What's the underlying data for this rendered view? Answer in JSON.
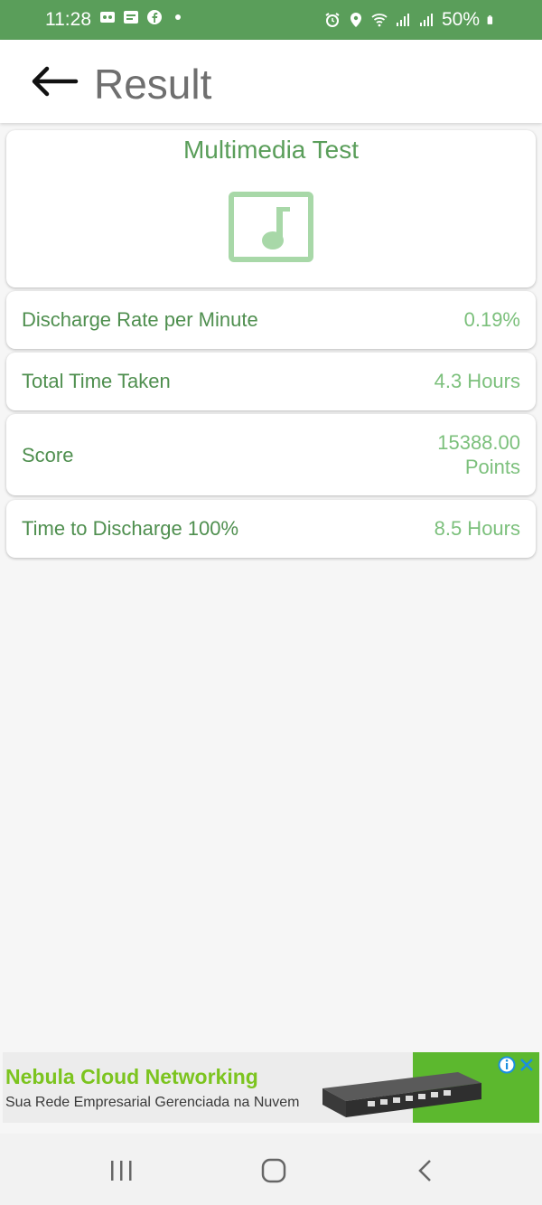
{
  "status_bar": {
    "time": "11:28",
    "battery": "50%",
    "icons": [
      "voicemail-icon",
      "message-icon",
      "facebook-icon",
      "dot-icon",
      "alarm-icon",
      "location-icon",
      "wifi-icon",
      "signal-icon",
      "signal-icon",
      "battery-icon"
    ]
  },
  "app_bar": {
    "title": "Result",
    "back_icon": "arrow-left-icon"
  },
  "test": {
    "title": "Multimedia Test",
    "icon": "music-note-icon"
  },
  "results": [
    {
      "label": "Discharge Rate per Minute",
      "value": "0.19%"
    },
    {
      "label": "Total Time Taken",
      "value": "4.3 Hours"
    },
    {
      "label": "Score",
      "value_line1": "15388.00",
      "value_line2": "Points"
    },
    {
      "label": "Time to Discharge 100%",
      "value": "8.5 Hours"
    }
  ],
  "ad": {
    "title": "Nebula Cloud Networking",
    "subtitle": "Sua Rede Empresarial Gerenciada na Nuvem",
    "icons": [
      "info-icon",
      "close-icon"
    ]
  },
  "nav_bar": {
    "icons": [
      "recent-apps-icon",
      "home-icon",
      "back-icon"
    ]
  },
  "colors": {
    "status_bar": "#5a9e5a",
    "accent_green": "#5a9e5a",
    "value_green": "#7cc07c",
    "icon_green": "#a8d8a8",
    "background": "#f6f6f6"
  }
}
